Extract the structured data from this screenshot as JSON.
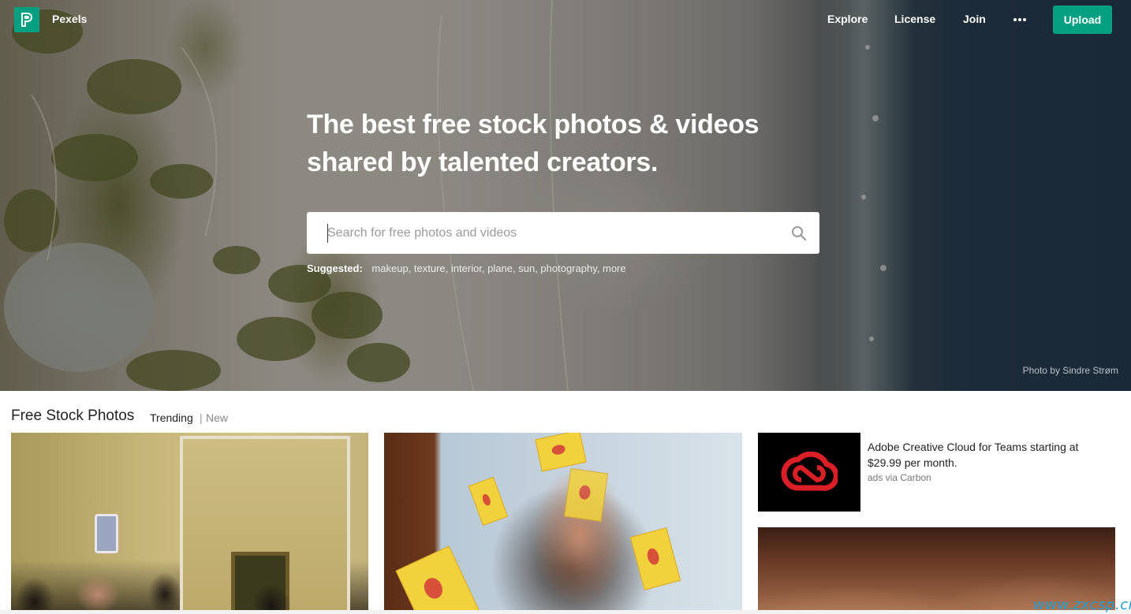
{
  "header": {
    "brand": "Pexels",
    "nav": {
      "explore": "Explore",
      "license": "License",
      "join": "Join",
      "upload": "Upload"
    }
  },
  "hero": {
    "headline_line1": "The best free stock photos & videos",
    "headline_line2": "shared by talented creators.",
    "search_placeholder": "Search for free photos and videos",
    "suggested_label": "Suggested:",
    "suggestions": [
      "makeup,",
      "texture,",
      "interior,",
      "plane,",
      "sun,",
      "photography,",
      "more"
    ],
    "photo_credit": "Photo by Sindre Strøm"
  },
  "section": {
    "title": "Free Stock Photos",
    "tab_trending": "Trending",
    "separator": "|",
    "tab_new": "New"
  },
  "ad": {
    "text": "Adobe Creative Cloud for Teams starting at $29.99 per month.",
    "via": "ads via Carbon"
  },
  "watermark": "www.zxcsp.cn",
  "colors": {
    "brand_green": "#05a081",
    "adobe_red": "#da1f26"
  }
}
